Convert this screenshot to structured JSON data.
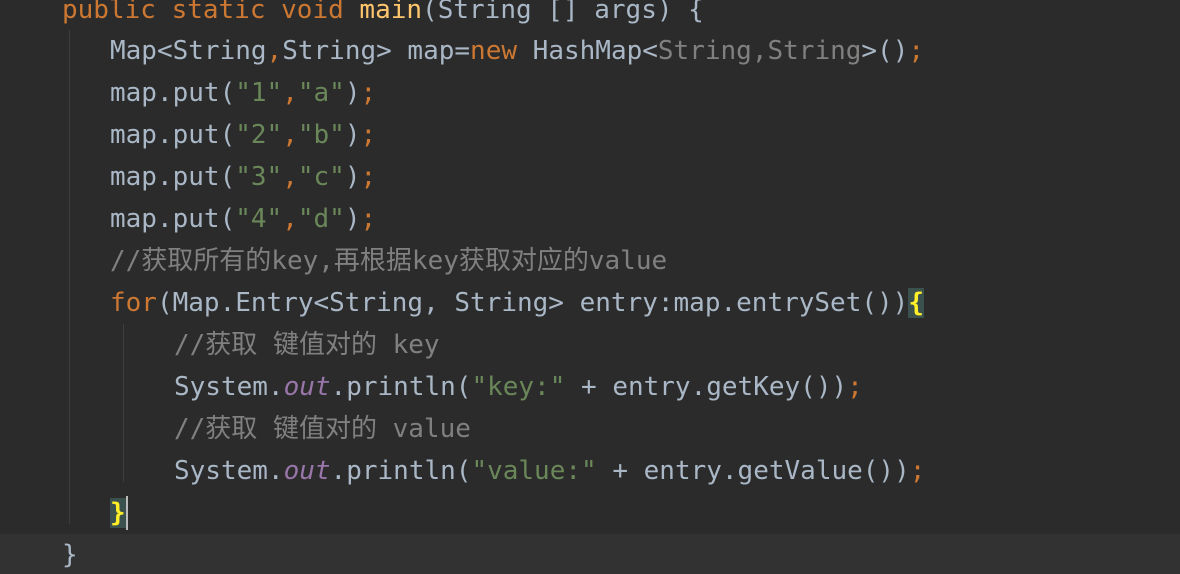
{
  "editor": {
    "lines": [
      [
        {
          "t": "public static void ",
          "c": "kw"
        },
        {
          "t": "main",
          "c": "fn"
        },
        {
          "t": "(String [] args) {",
          "c": "df"
        }
      ],
      [
        {
          "t": "Map<String",
          "c": "df"
        },
        {
          "t": ",",
          "c": "kw"
        },
        {
          "t": "String> map=",
          "c": "df"
        },
        {
          "t": "new ",
          "c": "kw"
        },
        {
          "t": "HashMap<",
          "c": "df"
        },
        {
          "t": "String,String",
          "c": "gen"
        },
        {
          "t": ">()",
          "c": "df"
        },
        {
          "t": ";",
          "c": "kw"
        }
      ],
      [
        {
          "t": "map.put(",
          "c": "df"
        },
        {
          "t": "\"1\"",
          "c": "str"
        },
        {
          "t": ",",
          "c": "kw"
        },
        {
          "t": "\"a\"",
          "c": "str"
        },
        {
          "t": ")",
          "c": "df"
        },
        {
          "t": ";",
          "c": "kw"
        }
      ],
      [
        {
          "t": "map.put(",
          "c": "df"
        },
        {
          "t": "\"2\"",
          "c": "str"
        },
        {
          "t": ",",
          "c": "kw"
        },
        {
          "t": "\"b\"",
          "c": "str"
        },
        {
          "t": ")",
          "c": "df"
        },
        {
          "t": ";",
          "c": "kw"
        }
      ],
      [
        {
          "t": "map.put(",
          "c": "df"
        },
        {
          "t": "\"3\"",
          "c": "str"
        },
        {
          "t": ",",
          "c": "kw"
        },
        {
          "t": "\"c\"",
          "c": "str"
        },
        {
          "t": ")",
          "c": "df"
        },
        {
          "t": ";",
          "c": "kw"
        }
      ],
      [
        {
          "t": "map.put(",
          "c": "df"
        },
        {
          "t": "\"4\"",
          "c": "str"
        },
        {
          "t": ",",
          "c": "kw"
        },
        {
          "t": "\"d\"",
          "c": "str"
        },
        {
          "t": ")",
          "c": "df"
        },
        {
          "t": ";",
          "c": "kw"
        }
      ],
      [
        {
          "t": "//获取所有的key,再根据key获取对应的value",
          "c": "cm"
        }
      ],
      [
        {
          "t": "for",
          "c": "kw"
        },
        {
          "t": "(Map.Entry<String, String> entry:map.entrySet())",
          "c": "df"
        },
        {
          "t": "{",
          "c": "brace"
        }
      ],
      [
        {
          "t": "//获取 键值对的 key",
          "c": "cm"
        }
      ],
      [
        {
          "t": "System.",
          "c": "df"
        },
        {
          "t": "out",
          "c": "fld"
        },
        {
          "t": ".println(",
          "c": "df"
        },
        {
          "t": "\"key:\"",
          "c": "str"
        },
        {
          "t": " + entry.getKey())",
          "c": "df"
        },
        {
          "t": ";",
          "c": "kw"
        }
      ],
      [
        {
          "t": "//获取 键值对的 value",
          "c": "cm"
        }
      ],
      [
        {
          "t": "System.",
          "c": "df"
        },
        {
          "t": "out",
          "c": "fld"
        },
        {
          "t": ".println(",
          "c": "df"
        },
        {
          "t": "\"value:\"",
          "c": "str"
        },
        {
          "t": " + entry.getValue())",
          "c": "df"
        },
        {
          "t": ";",
          "c": "kw"
        }
      ],
      [
        {
          "t": "}",
          "c": "brace"
        }
      ],
      [
        {
          "t": "}",
          "c": "df"
        }
      ]
    ],
    "current_line": 13,
    "colors": {
      "background": "#2b2b2b",
      "current_line": "#323232",
      "keyword": "#cc7832",
      "function": "#ffc66d",
      "string": "#6a8759",
      "comment": "#808080",
      "default": "#a9b7c6",
      "static_field": "#9876aa",
      "matched_brace": "#ffef28",
      "matched_brace_bg": "#3b514d"
    }
  }
}
